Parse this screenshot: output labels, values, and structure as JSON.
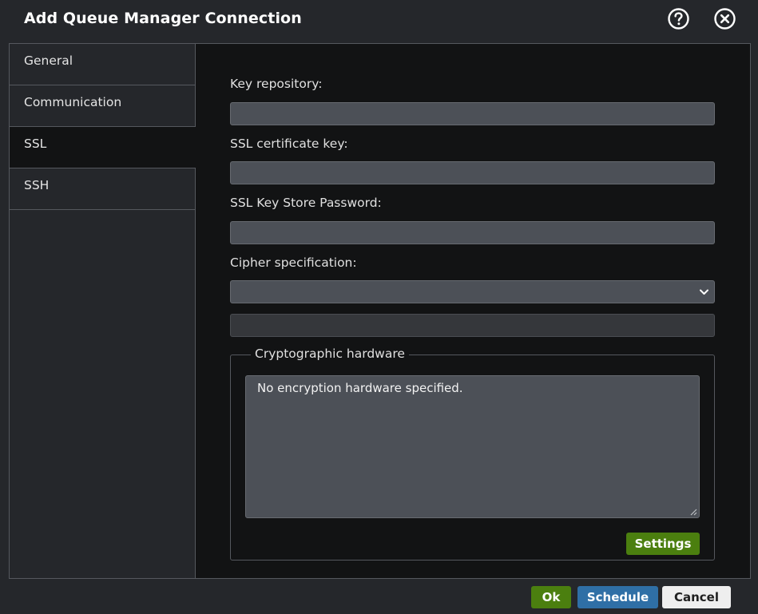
{
  "dialog": {
    "title": "Add Queue Manager Connection",
    "help_icon": "help-icon",
    "close_icon": "close-icon"
  },
  "sidebar": {
    "items": [
      {
        "label": "General",
        "active": false
      },
      {
        "label": "Communication",
        "active": false
      },
      {
        "label": "SSL",
        "active": true
      },
      {
        "label": "SSH",
        "active": false
      }
    ]
  },
  "form": {
    "key_repository": {
      "label": "Key repository:",
      "value": ""
    },
    "ssl_certificate_key": {
      "label": "SSL certificate key:",
      "value": ""
    },
    "ssl_key_store_password": {
      "label": "SSL Key Store Password:",
      "value": ""
    },
    "cipher_specification": {
      "label": "Cipher specification:",
      "selected": "",
      "extra_value": ""
    },
    "cryptographic_hardware": {
      "legend": "Cryptographic hardware",
      "text": "No encryption hardware specified.",
      "settings_label": "Settings"
    }
  },
  "footer": {
    "ok_label": "Ok",
    "schedule_label": "Schedule",
    "cancel_label": "Cancel"
  },
  "colors": {
    "background": "#25272b",
    "panel": "#121314",
    "field": "#4c5057",
    "ok_green": "#4b7f0f",
    "schedule_blue": "#2f6fa6",
    "cancel_light": "#eeeeee"
  }
}
